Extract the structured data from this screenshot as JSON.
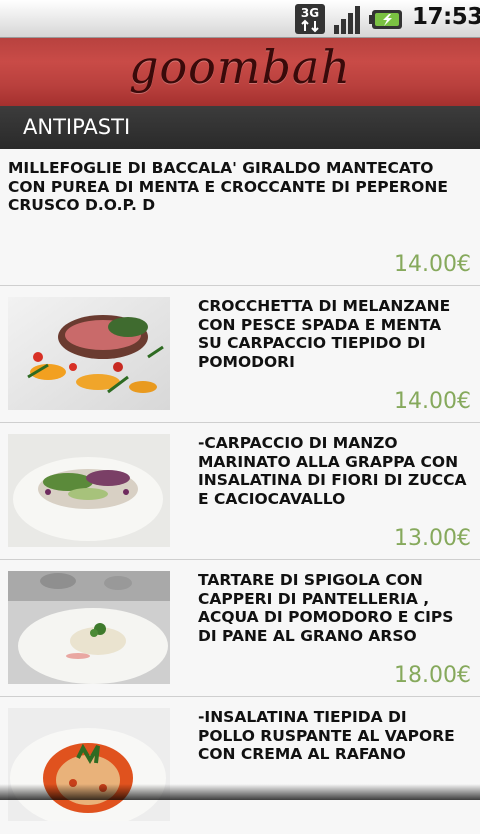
{
  "status_bar": {
    "network": "3G",
    "time": "17:53",
    "icons": [
      "network-3g-icon",
      "signal-icon",
      "battery-charging-icon"
    ]
  },
  "app": {
    "logo_text": "goombah"
  },
  "section": {
    "title": "ANTIPASTI"
  },
  "items": [
    {
      "name": "MILLEFOGLIE DI BACCALA' GIRALDO MANTECATO CON PUREA DI MENTA E CROCCANTE DI PEPERONE CRUSCO D.O.P. D",
      "price": "14.00€",
      "has_image": false
    },
    {
      "name": "CROCCHETTA DI MELANZANE CON PESCE SPADA E MENTA SU CARPACCIO TIEPIDO DI POMODORI",
      "price": "14.00€",
      "has_image": true,
      "image_icon": "swordfish-dish-photo"
    },
    {
      "name": "-CARPACCIO DI MANZO MARINATO ALLA GRAPPA CON INSALATINA DI FIORI DI ZUCCA E CACIOCAVALLO",
      "price": "13.00€",
      "has_image": true,
      "image_icon": "beef-carpaccio-photo"
    },
    {
      "name": "TARTARE DI SPIGOLA CON CAPPERI DI PANTELLERIA , ACQUA DI POMODORO E CIPS DI PANE AL GRANO ARSO",
      "price": "18.00€",
      "has_image": true,
      "image_icon": "sea-bass-tartare-photo"
    },
    {
      "name": "-INSALATINA TIEPIDA DI POLLO RUSPANTE AL VAPORE CON CREMA AL RAFANO",
      "price": "",
      "has_image": true,
      "image_icon": "chicken-salad-photo"
    }
  ],
  "colors": {
    "app_bar": "#c0443f",
    "section_bar": "#333333",
    "price": "#86a95c",
    "background": "#f7f7f7"
  }
}
